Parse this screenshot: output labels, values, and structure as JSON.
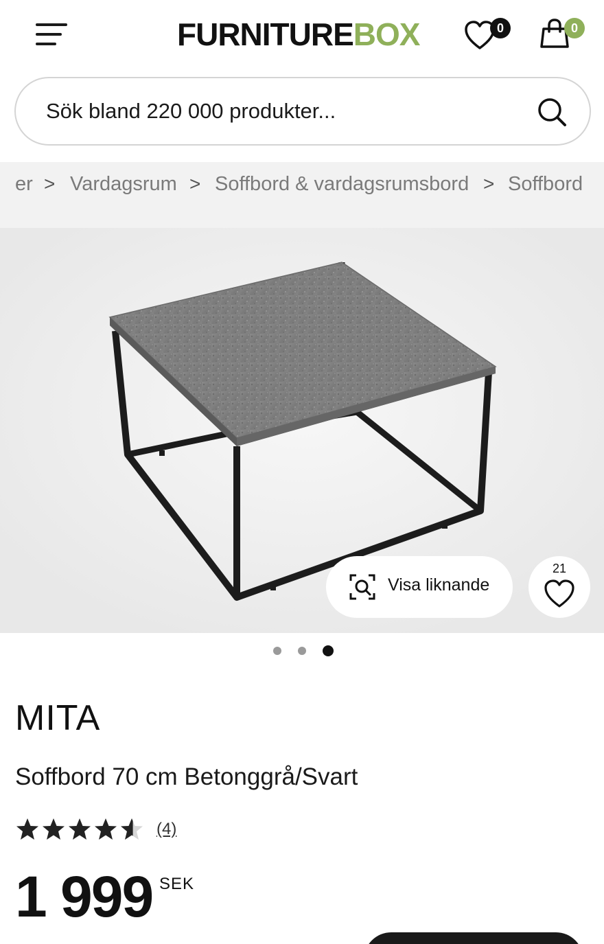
{
  "header": {
    "logo_part1": "FURNITURE",
    "logo_part2": "BOX",
    "wishlist_count": "0",
    "cart_count": "0",
    "brand_color": "#8fb05a"
  },
  "search": {
    "placeholder": "Sök bland 220 000 produkter..."
  },
  "breadcrumb": {
    "items": [
      "er",
      "Vardagsrum",
      "Soffbord & vardagsrumsbord",
      "Soffbord"
    ],
    "separator": ">"
  },
  "gallery": {
    "similar_label": "Visa liknande",
    "favorite_count": "21",
    "slide_count": 3,
    "active_slide": 3
  },
  "product": {
    "brand": "MITA",
    "title": "Soffbord 70 cm Betonggrå/Svart",
    "rating": 4.5,
    "rating_max": 5,
    "review_count": "(4)",
    "price": "1 999",
    "currency": "SEK"
  }
}
